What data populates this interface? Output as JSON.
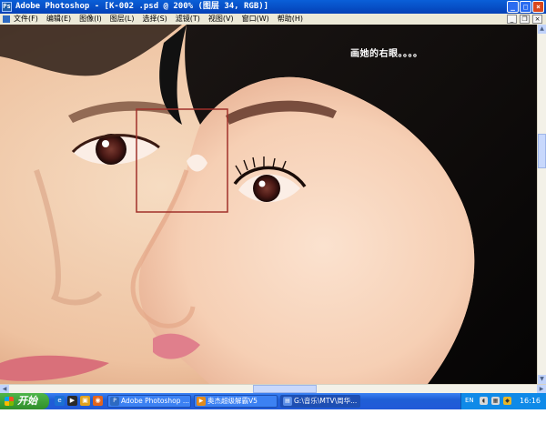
{
  "window": {
    "app_icon": "Ps",
    "title": "Adobe Photoshop - [K-002 .psd @ 200% (图层 34, RGB)]",
    "controls": {
      "minimize": "_",
      "maximize": "□",
      "close": "×"
    }
  },
  "menubar": {
    "items": [
      "文件(F)",
      "编辑(E)",
      "图像(I)",
      "图层(L)",
      "选择(S)",
      "滤镜(T)",
      "视图(V)",
      "窗口(W)",
      "帮助(H)"
    ],
    "doc_controls": {
      "minimize": "_",
      "restore": "❐",
      "close": "×"
    }
  },
  "canvas": {
    "annotation": "画她的右眼。。。。",
    "marquee_color": "#a0302a"
  },
  "scrollbars": {
    "up": "▲",
    "down": "▼",
    "left": "◀",
    "right": "▶"
  },
  "taskbar": {
    "start_label": "开始",
    "quick_launch": [
      {
        "icon": "ie-icon",
        "glyph": "e"
      },
      {
        "icon": "media-player-icon",
        "glyph": "▶"
      },
      {
        "icon": "folder-icon",
        "glyph": "▣"
      },
      {
        "icon": "firefox-icon",
        "glyph": "◉"
      }
    ],
    "tasks": [
      {
        "label": "Adobe Photoshop ...",
        "icon": "photoshop-icon",
        "active": false
      },
      {
        "label": "奥杰超级解霸V5",
        "icon": "player-icon",
        "active": false
      },
      {
        "label": "G:\\音乐\\MTV\\周华...",
        "icon": "folder-window-icon",
        "active": true
      }
    ],
    "tray": {
      "lang": "EN",
      "clock": "16:16"
    }
  },
  "colors": {
    "xp_blue": "#0440b6",
    "menu_bg": "#ece9d8",
    "skin": "#f3cfb0",
    "hair": "#0d0b0a"
  }
}
